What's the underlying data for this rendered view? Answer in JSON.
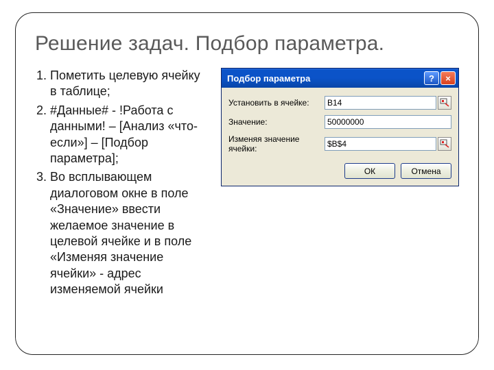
{
  "slide": {
    "title": "Решение задач. Подбор параметра.",
    "steps": [
      "Пометить целевую ячейку в таблице;",
      "#Данные# - !Работа с данными! – [Анализ «что-если»] – [Подбор параметра];",
      "Во всплывающем диалоговом окне в поле «Значение» ввести желаемое значение в целевой ячейке и в поле «Изменяя значение ячейки» - адрес изменяемой ячейки"
    ]
  },
  "dialog": {
    "title": "Подбор параметра",
    "help_char": "?",
    "close_char": "×",
    "fields": {
      "set_cell": {
        "label": "Установить в ячейке:",
        "value": "B14"
      },
      "to_value": {
        "label": "Значение:",
        "value": "50000000"
      },
      "by_changing": {
        "label": "Изменяя значение ячейки:",
        "value": "$B$4"
      }
    },
    "buttons": {
      "ok": "ОК",
      "cancel": "Отмена"
    }
  }
}
